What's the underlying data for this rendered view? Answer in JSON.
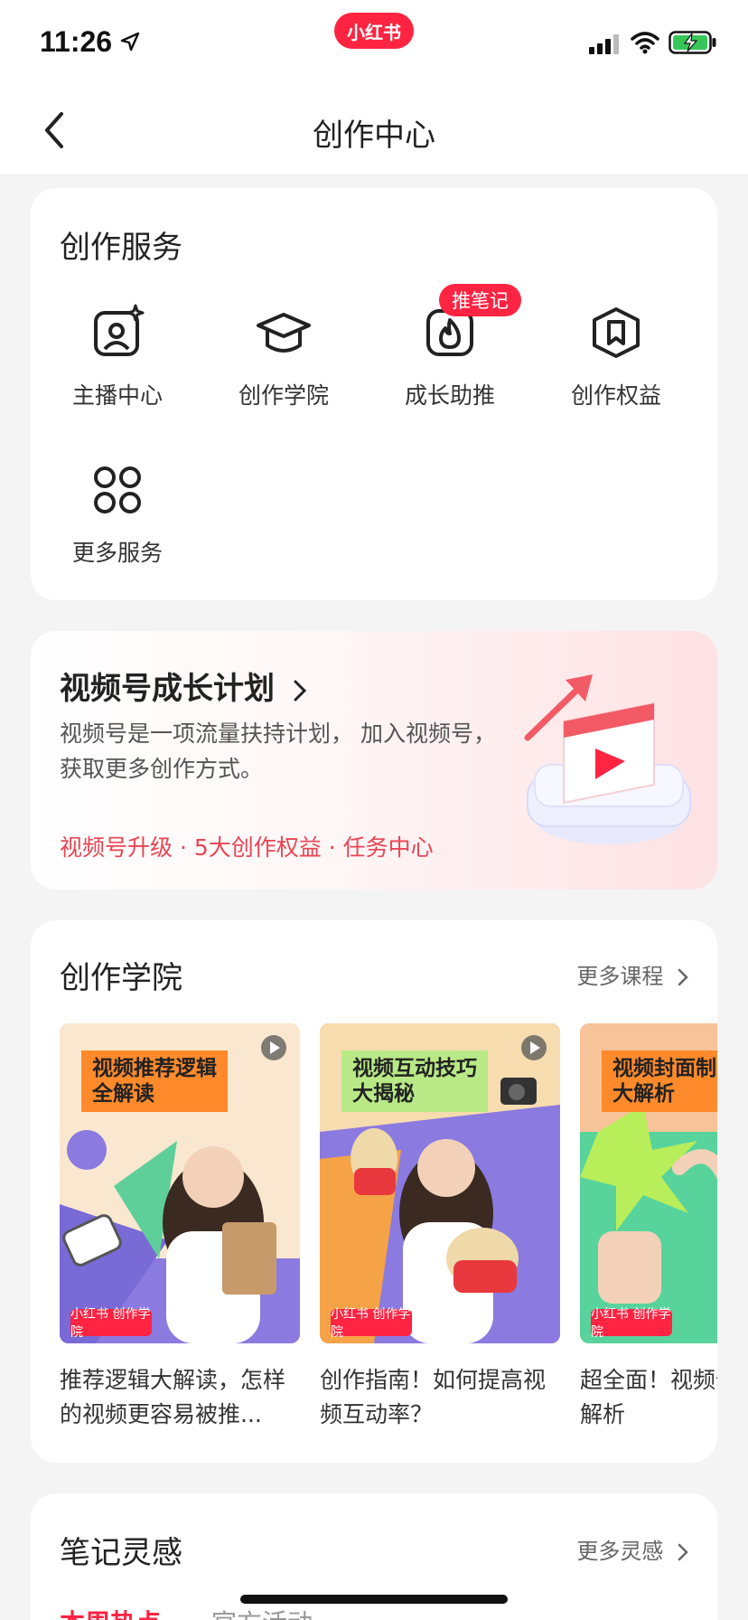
{
  "status_bar": {
    "time": "11:26",
    "app_pill": "小红书",
    "icons": [
      "location-arrow-icon",
      "signal-icon",
      "wifi-icon",
      "battery-charging-icon"
    ]
  },
  "nav": {
    "title": "创作中心",
    "back_icon": "back-chevron-icon"
  },
  "services": {
    "title": "创作服务",
    "badge": "推笔记",
    "items": [
      {
        "label": "主播中心",
        "icon": "host-portrait-icon"
      },
      {
        "label": "创作学院",
        "icon": "graduation-cap-icon"
      },
      {
        "label": "成长助推",
        "icon": "flame-icon"
      },
      {
        "label": "创作权益",
        "icon": "bookmark-shield-icon"
      },
      {
        "label": "更多服务",
        "icon": "grid-four-circles-icon"
      }
    ]
  },
  "growth": {
    "title": "视频号成长计划",
    "desc": "视频号是一项流量扶持计划， 加入视频号，获取更多创作方式。",
    "links": "视频号升级 · 5大创作权益 · 任务中心"
  },
  "academy": {
    "title": "创作学院",
    "more": "更多课程",
    "courses": [
      {
        "banner": "视频推荐逻辑\n全解读",
        "title": "推荐逻辑大解读，怎样的视频更容易被推...",
        "logo": "小红书 创作学院"
      },
      {
        "banner": "视频互动技巧\n大揭秘",
        "title": "创作指南！如何提高视频互动率？",
        "logo": "小红书 创作学院"
      },
      {
        "banner": "视频封面制\n大解析",
        "title": "超全面！视频作技巧大解析",
        "logo": "小红书 创作学院"
      }
    ]
  },
  "inspiration": {
    "title": "笔记灵感",
    "more": "更多灵感",
    "tabs": [
      "本周热点",
      "官方活动"
    ]
  },
  "colors": {
    "brand": "#ff2442",
    "accent_text": "#e84553",
    "background": "#f4f4f5"
  }
}
